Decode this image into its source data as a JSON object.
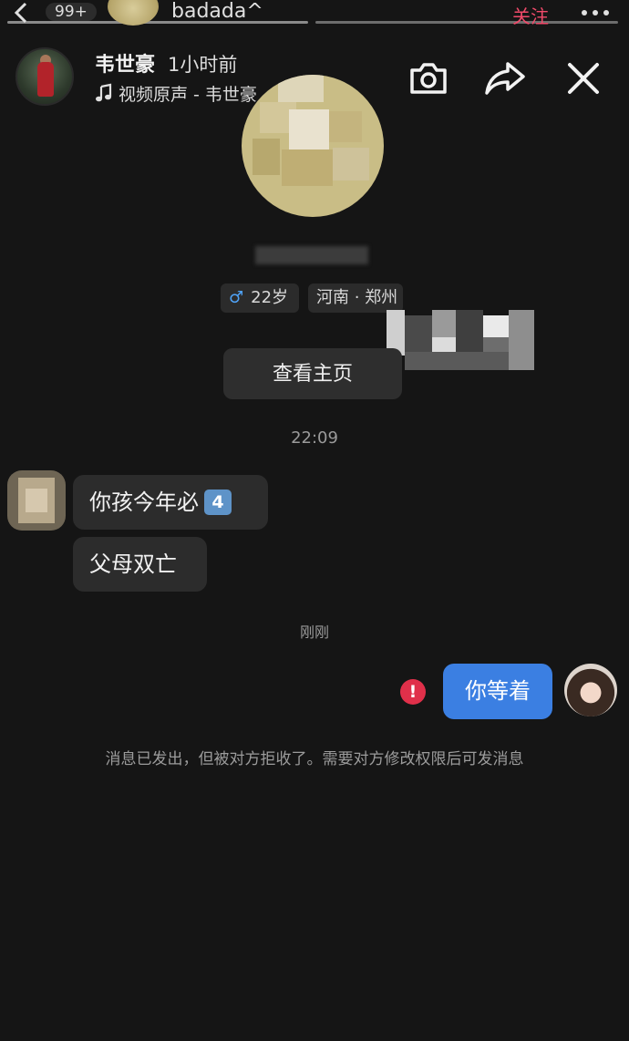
{
  "top_bar": {
    "badge_count": "99+",
    "username": "badada^",
    "follow_label": "关注"
  },
  "header": {
    "name": "韦世豪",
    "time": "1小时前",
    "audio": "视频原声 - 韦世豪",
    "icons": [
      "camera-icon",
      "share-icon",
      "close-icon",
      "music-note-icon"
    ]
  },
  "profile": {
    "age_symbol": "♂",
    "age": "22岁",
    "location": "河南 · 郑州",
    "view_profile_label": "查看主页"
  },
  "chat": {
    "timestamp_1": "22:09",
    "incoming_messages": [
      {
        "text": "你孩今年必",
        "emoji": "4"
      },
      {
        "text": "父母双亡"
      }
    ],
    "timestamp_2": "刚刚",
    "outgoing_message": "你等着",
    "error_mark": "!",
    "system_note": "消息已发出，但被对方拒收了。需要对方修改权限后可发消息"
  },
  "colors": {
    "background": "#151515",
    "bubble_incoming": "#2c2c2c",
    "bubble_outgoing": "#3b7fe2",
    "error": "#e0304a",
    "follow": "#f04a6a"
  }
}
